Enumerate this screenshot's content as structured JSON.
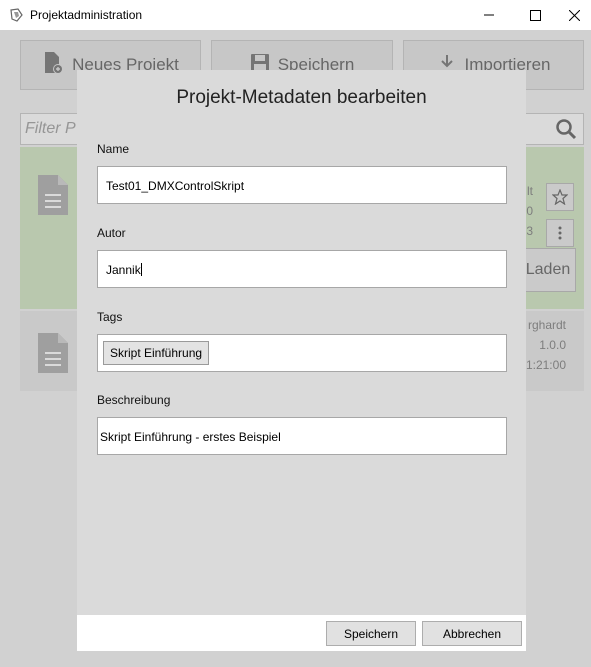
{
  "window": {
    "title": "Projektadministration"
  },
  "toolbar": {
    "new_project_label": "Neues Projekt",
    "save_label": "Speichern",
    "import_label": "Importieren"
  },
  "filter": {
    "placeholder": "Filter P"
  },
  "projects": [
    {
      "meta_lines": [
        "lt",
        "0",
        "3"
      ],
      "load_label": "Laden",
      "highlighted": true
    },
    {
      "meta_lines": [
        "rghardt",
        "1.0.0",
        "1:21:00"
      ],
      "highlighted": false
    }
  ],
  "dialog": {
    "title": "Projekt-Metadaten bearbeiten",
    "name_label": "Name",
    "name_value": "Test01_DMXControlSkript",
    "author_label": "Autor",
    "author_value": "Jannik",
    "tags_label": "Tags",
    "tags": [
      "Skript Einführung"
    ],
    "description_label": "Beschreibung",
    "description_value": "Skript Einführung - erstes Beispiel",
    "save_button": "Speichern",
    "cancel_button": "Abbrechen"
  },
  "colors": {
    "selected_card": "#cfe5bf",
    "dialog_bg": "#dadada"
  }
}
